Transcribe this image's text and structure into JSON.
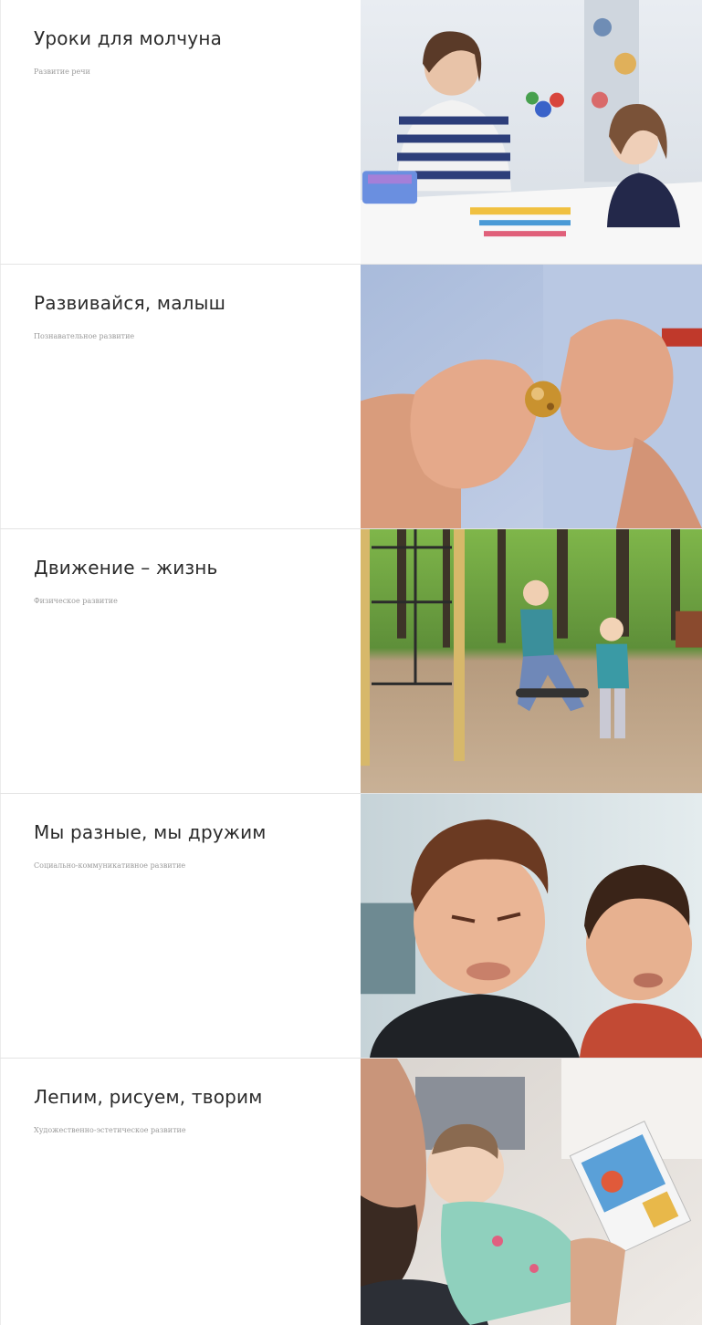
{
  "programs": [
    {
      "title": "Уроки для молчуна",
      "category": "Развитие речи",
      "photo": "speech-lesson-photo"
    },
    {
      "title": "Развивайся, малыш",
      "category": "Познавательное развитие",
      "photo": "child-hands-bead-photo"
    },
    {
      "title": "Движение – жизнь",
      "category": "Физическое развитие",
      "photo": "kids-swing-park-photo"
    },
    {
      "title": "Мы разные, мы дружим",
      "category": "Социально-коммуникативное развитие",
      "photo": "boys-funny-faces-photo"
    },
    {
      "title": "Лепим, рисуем, творим",
      "category": "Художественно-эстетическое развитие",
      "photo": "father-baby-book-photo"
    }
  ]
}
